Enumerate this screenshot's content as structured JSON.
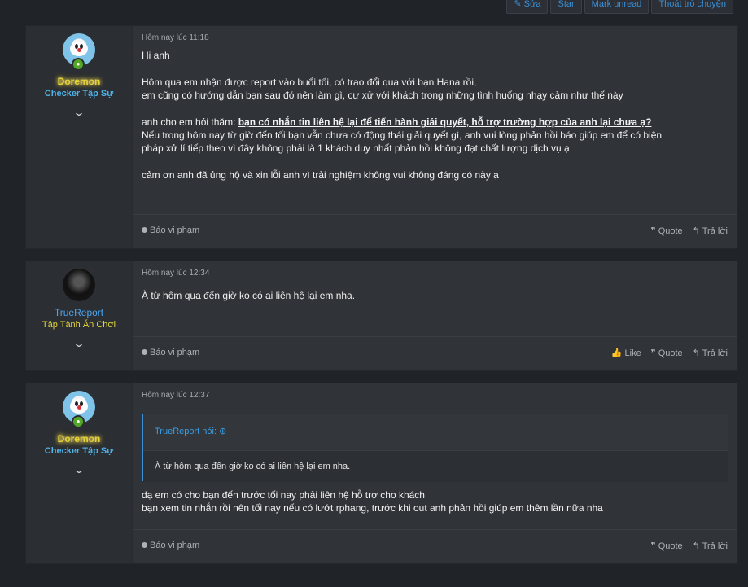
{
  "toolbar": {
    "edit": "✎ Sửa",
    "star": "Star",
    "mark_unread": "Mark unread",
    "leave": "Thoát trò chuyện"
  },
  "posts": [
    {
      "user": {
        "name": "Doremon",
        "title": "Checker Tập Sự"
      },
      "time": "Hôm nay lúc 11:18",
      "lines": {
        "l1": "Hi anh",
        "l2": "Hôm qua em nhận được report vào buổi tối, có trao đổi qua với bạn Hana rồi,",
        "l3": "em cũng có hướng dẫn bạn sau đó nên làm gì, cư xử với khách trong những tình huống nhạy cảm như thế này",
        "l4a": "anh cho em hỏi thăm: ",
        "l4b": "bạn có nhắn tin liên hệ lại để tiến hành giải quyết, hỗ trợ trường hợp của anh lại chưa ạ?",
        "l5": "Nếu trong hôm nay từ giờ đến tối bạn vẫn chưa có động thái giải quyết gì, anh vui lòng phản hồi báo giúp em để có biện",
        "l6": "pháp xử lí tiếp theo vì đây không phải là 1 khách duy nhất phản hồi không đạt chất lượng dịch vụ ạ",
        "l7": "cảm ơn anh đã ủng hộ và xin lỗi anh vì trải nghiệm không vui không đáng có này ạ"
      },
      "report": "Báo vi phạm",
      "quote": "❞ Quote",
      "reply": "↰ Trả lời"
    },
    {
      "user": {
        "name": "TrueReport",
        "title": "Tập Tành Ăn Chơi"
      },
      "time": "Hôm nay lúc 12:34",
      "lines": {
        "l1": "À từ hôm qua đến giờ ko có ai liên hệ lại em nha."
      },
      "report": "Báo vi phạm",
      "like": "👍 Like",
      "quote": "❞ Quote",
      "reply": "↰ Trả lời"
    },
    {
      "user": {
        "name": "Doremon",
        "title": "Checker Tập Sự"
      },
      "time": "Hôm nay lúc 12:37",
      "quoted": {
        "author": "TrueReport nói: ⊕",
        "text": "À từ hôm qua đến giờ ko có ai liên hệ lại em nha."
      },
      "lines": {
        "l1": "dạ em có cho bạn đến trước tối nay phải liên hệ hỗ trợ cho khách",
        "l2": "bạn xem tin nhắn rồi nên tối nay nếu có lướt rphang, trước khi out anh phản hồi giúp em thêm lần nữa nha"
      },
      "report": "Báo vi phạm",
      "quote": "❞ Quote",
      "reply": "↰ Trả lời"
    }
  ],
  "icons": {
    "chevron": "chevron-down-icon",
    "online": "online-badge-icon"
  }
}
